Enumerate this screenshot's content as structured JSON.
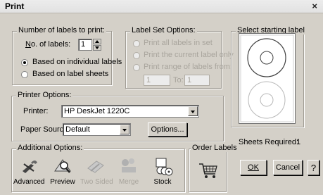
{
  "window": {
    "title": "Print",
    "close_glyph": "×"
  },
  "number_of_labels": {
    "legend": "Number of labels to print:",
    "count_label_prefix": "",
    "count_label_accel": "N",
    "count_label_rest": "o. of labels:",
    "count_value": "1",
    "options": [
      {
        "label": "Based on individual labels",
        "selected": true
      },
      {
        "label": "Based on label sheets",
        "selected": false
      }
    ]
  },
  "label_set": {
    "legend": "Label Set Options:",
    "options": [
      {
        "label": "Print all labels in set"
      },
      {
        "label": "Print the current label only"
      },
      {
        "label": "Print range of labels from:"
      }
    ],
    "range_from": "1",
    "to_label": "To:",
    "range_to": "1"
  },
  "starting_label": {
    "legend": "Select starting label",
    "sheets_required_label": "Sheets Required:",
    "sheets_required_value": "1"
  },
  "printer_options": {
    "legend": "Printer Options:",
    "printer_label": "Printer:",
    "printer_value": "HP DeskJet 1220C",
    "paper_source_label": "Paper Source:",
    "paper_source_value": "Default",
    "options_button": "Options..."
  },
  "additional_options": {
    "legend": "Additional Options:",
    "tools": [
      {
        "label": "Advanced",
        "icon": "advanced-icon",
        "enabled": true
      },
      {
        "label": "Preview",
        "icon": "preview-icon",
        "enabled": true
      },
      {
        "label": "Two Sided",
        "icon": "two-sided-icon",
        "enabled": false
      },
      {
        "label": "Merge",
        "icon": "merge-icon",
        "enabled": false
      },
      {
        "label": "Stock",
        "icon": "stock-icon",
        "enabled": true
      }
    ]
  },
  "order_labels": {
    "legend": "Order Labels",
    "icon": "shopping-cart-icon"
  },
  "buttons": {
    "ok": "OK",
    "cancel": "Cancel",
    "help": "?"
  },
  "colors": {
    "dialog_bg": "#d4d0c8",
    "disabled_text": "#a8a49c"
  }
}
